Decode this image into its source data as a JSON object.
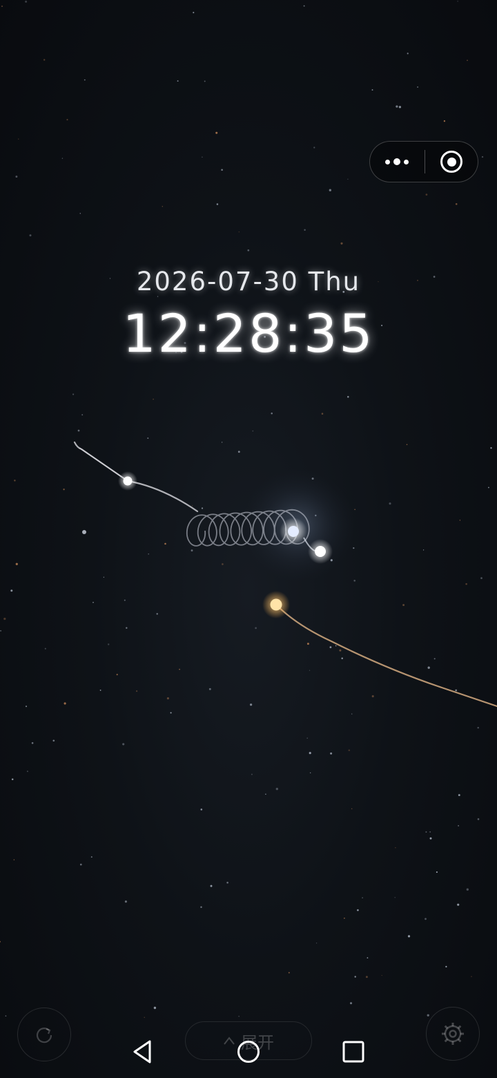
{
  "clock": {
    "date": "2026-07-30 Thu",
    "time": "12:28:35"
  },
  "capsule": {
    "more_icon": "more-dots-icon",
    "close_icon": "target-circle-icon"
  },
  "controls": {
    "refresh_icon": "refresh-icon",
    "expand_label": "展开",
    "expand_icon": "caret-up-icon",
    "settings_icon": "gear-icon"
  },
  "navbar": {
    "back_icon": "back-triangle-icon",
    "home_icon": "home-circle-icon",
    "recent_icon": "recent-square-icon"
  },
  "colors": {
    "background": "#0c0f14",
    "star_white": "#ffffff",
    "star_blue": "#dfe8ff",
    "star_orange": "#ffd27a",
    "trail_orange": "#c9a27a"
  }
}
